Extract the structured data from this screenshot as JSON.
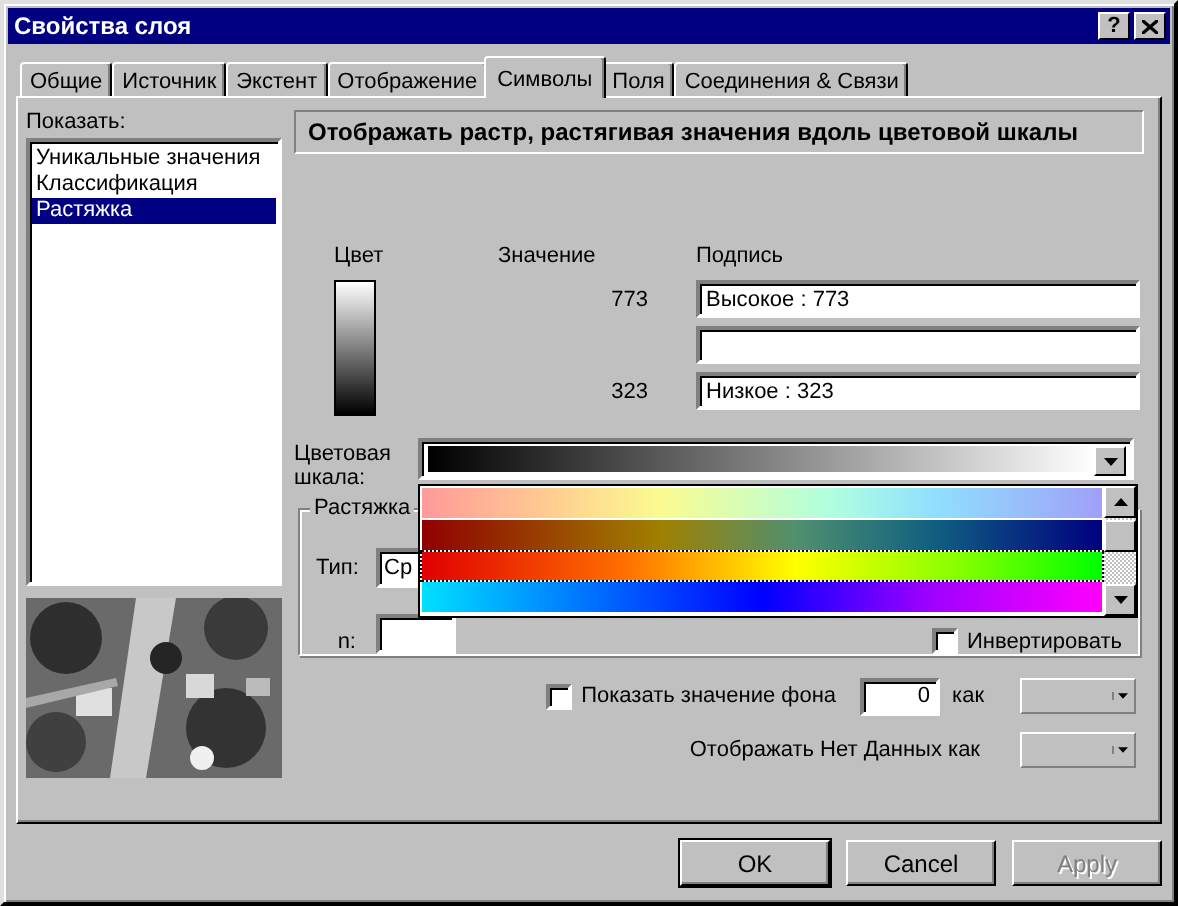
{
  "window": {
    "title": "Свойства слоя",
    "help": "?"
  },
  "tabs": [
    {
      "label": "Общие",
      "selected": false
    },
    {
      "label": "Источник",
      "selected": false
    },
    {
      "label": "Экстент",
      "selected": false
    },
    {
      "label": "Отображение",
      "selected": false
    },
    {
      "label": "Символы",
      "selected": true
    },
    {
      "label": "Поля",
      "selected": false
    },
    {
      "label": "Соединения & Связи",
      "selected": false
    }
  ],
  "show_label": "Показать:",
  "renderers": [
    {
      "label": "Уникальные значения",
      "selected": false
    },
    {
      "label": "Классификация",
      "selected": false
    },
    {
      "label": "Растяжка",
      "selected": true
    }
  ],
  "preview": {
    "kind": "picture"
  },
  "header": "Отображать растр, растягивая значения вдоль цветовой шкалы",
  "headings": [
    "Цвет",
    "Значение",
    "Подпись"
  ],
  "rows": [
    {
      "value": "773",
      "label": "Высокое : 773"
    },
    {},
    {
      "value": "323",
      "label": "Низкое : 323"
    }
  ],
  "color_ramp": {
    "label": "Цветовая шкала:",
    "kind": "grayscale",
    "expanded": true,
    "options": [
      {
        "kind": "pastel",
        "selected": false
      },
      {
        "kind": "earth",
        "selected": false
      },
      {
        "kind": "fire",
        "selected": true
      },
      {
        "kind": "spectrum",
        "selected": false
      }
    ]
  },
  "stretch": {
    "title": "Растяжка",
    "type_label": "Тип:",
    "type_value": "Ср",
    "n_label": "n:",
    "invert": {
      "label": "Инвертировать",
      "checked": false
    }
  },
  "background": {
    "label": "Показать значение фона",
    "checked": false,
    "value": "0",
    "as_label": "как"
  },
  "nodata": {
    "label": "Отображать Нет Данных как"
  },
  "buttons": [
    {
      "label": "OK",
      "default": true,
      "disabled": false
    },
    {
      "label": "Cancel",
      "default": false,
      "disabled": false
    },
    {
      "label": "Apply",
      "default": false,
      "disabled": true
    }
  ]
}
